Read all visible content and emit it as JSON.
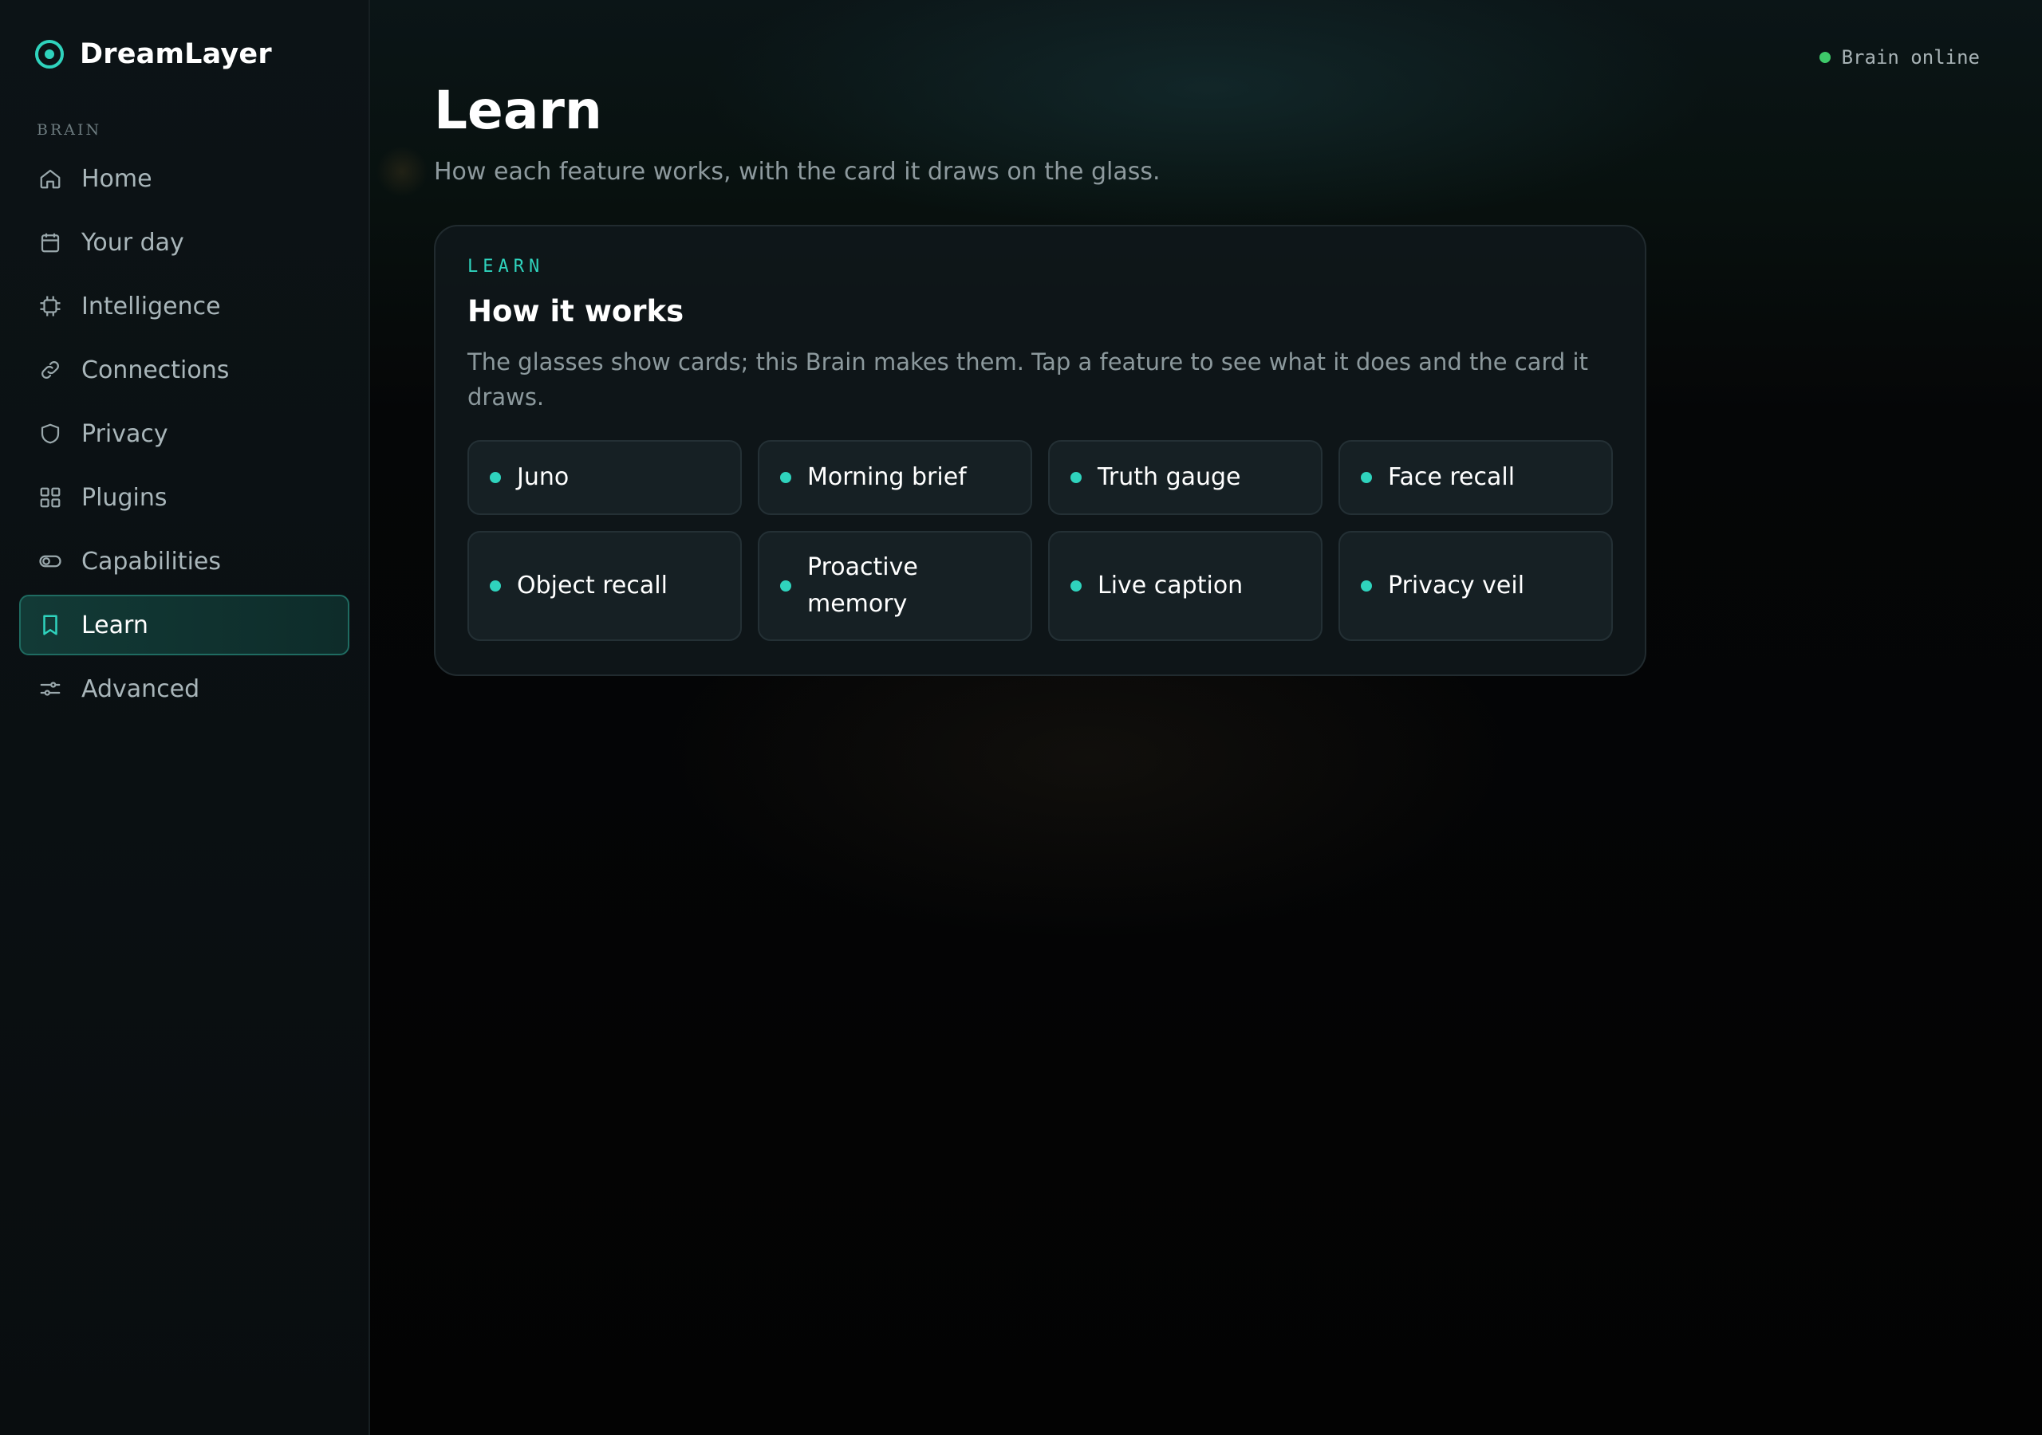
{
  "app": {
    "name": "DreamLayer"
  },
  "sidebar": {
    "section_label": "BRAIN",
    "items": [
      {
        "label": "Home",
        "icon": "home-icon",
        "active": false
      },
      {
        "label": "Your day",
        "icon": "calendar-icon",
        "active": false
      },
      {
        "label": "Intelligence",
        "icon": "chip-icon",
        "active": false
      },
      {
        "label": "Connections",
        "icon": "link-icon",
        "active": false
      },
      {
        "label": "Privacy",
        "icon": "shield-icon",
        "active": false
      },
      {
        "label": "Plugins",
        "icon": "grid-icon",
        "active": false
      },
      {
        "label": "Capabilities",
        "icon": "toggle-icon",
        "active": false
      },
      {
        "label": "Learn",
        "icon": "book-icon",
        "active": true
      },
      {
        "label": "Advanced",
        "icon": "sliders-icon",
        "active": false
      }
    ]
  },
  "status": {
    "label": "Brain online",
    "color": "#3ec96a"
  },
  "page": {
    "title": "Learn",
    "subtitle": "How each feature works, with the card it draws on the glass."
  },
  "card": {
    "eyebrow": "LEARN",
    "title": "How it works",
    "description": "The glasses show cards; this Brain makes them. Tap a feature to see what it does and the card it draws.",
    "features": [
      {
        "label": "Juno"
      },
      {
        "label": "Morning brief"
      },
      {
        "label": "Truth gauge"
      },
      {
        "label": "Face recall"
      },
      {
        "label": "Object recall"
      },
      {
        "label": "Proactive memory"
      },
      {
        "label": "Live caption"
      },
      {
        "label": "Privacy veil"
      }
    ]
  },
  "colors": {
    "accent": "#2fd3bd",
    "active_bg": "#123a36",
    "status_online": "#3ec96a"
  }
}
